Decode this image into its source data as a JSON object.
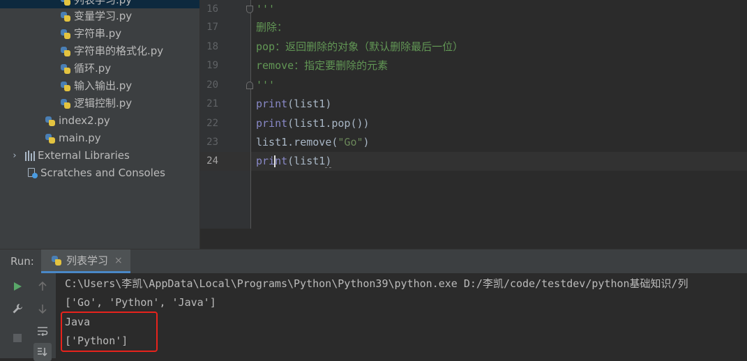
{
  "project_tree": {
    "items": [
      {
        "label": "列表学习.py",
        "type": "python-file"
      },
      {
        "label": "变量学习.py",
        "type": "python-file"
      },
      {
        "label": "字符串.py",
        "type": "python-file"
      },
      {
        "label": "字符串的格式化.py",
        "type": "python-file"
      },
      {
        "label": "循环.py",
        "type": "python-file"
      },
      {
        "label": "输入输出.py",
        "type": "python-file"
      },
      {
        "label": "逻辑控制.py",
        "type": "python-file"
      },
      {
        "label": "index2.py",
        "type": "python-file"
      },
      {
        "label": "main.py",
        "type": "python-file"
      },
      {
        "label": "External Libraries",
        "type": "library"
      },
      {
        "label": "Scratches and Consoles",
        "type": "scratch"
      }
    ]
  },
  "editor": {
    "line_numbers": [
      "16",
      "17",
      "18",
      "19",
      "20",
      "21",
      "22",
      "23",
      "24"
    ],
    "current_line": "24",
    "lines": {
      "l16": "'''",
      "l17": "删除：",
      "l18": "pop：返回删除的对象（默认删除最后一位）",
      "l19": "remove：指定要删除的元素",
      "l20": "'''",
      "l21": {
        "fn": "print",
        "rest": "(list1)"
      },
      "l22": {
        "fn": "print",
        "rest": "(list1.pop())"
      },
      "l23": {
        "pre": "list1.remove(",
        "str": "\"Go\"",
        "post": ")"
      },
      "l24": {
        "fn_a": "pri",
        "fn_b": "nt",
        "rest_a": "(list1",
        "rest_b": ")"
      }
    }
  },
  "run_panel": {
    "title": "Run:",
    "tab_label": "列表学习",
    "tab_close": "×",
    "console_lines": [
      "C:\\Users\\李凯\\AppData\\Local\\Programs\\Python\\Python39\\python.exe D:/李凯/code/testdev/python基础知识/列",
      "['Go', 'Python', 'Java']",
      "Java",
      "['Python']"
    ]
  },
  "icons": {
    "run": "play-icon",
    "rerun_up": "arrow-up-icon",
    "rerun_down": "arrow-down-icon",
    "settings": "wrench-icon",
    "wrap": "soft-wrap-icon",
    "stop": "stop-icon",
    "scroll_end": "scroll-to-end-icon"
  },
  "colors": {
    "highlight_box": "#e8231c",
    "docstring": "#629755",
    "builtin": "#8888c6",
    "string": "#6a8759"
  }
}
